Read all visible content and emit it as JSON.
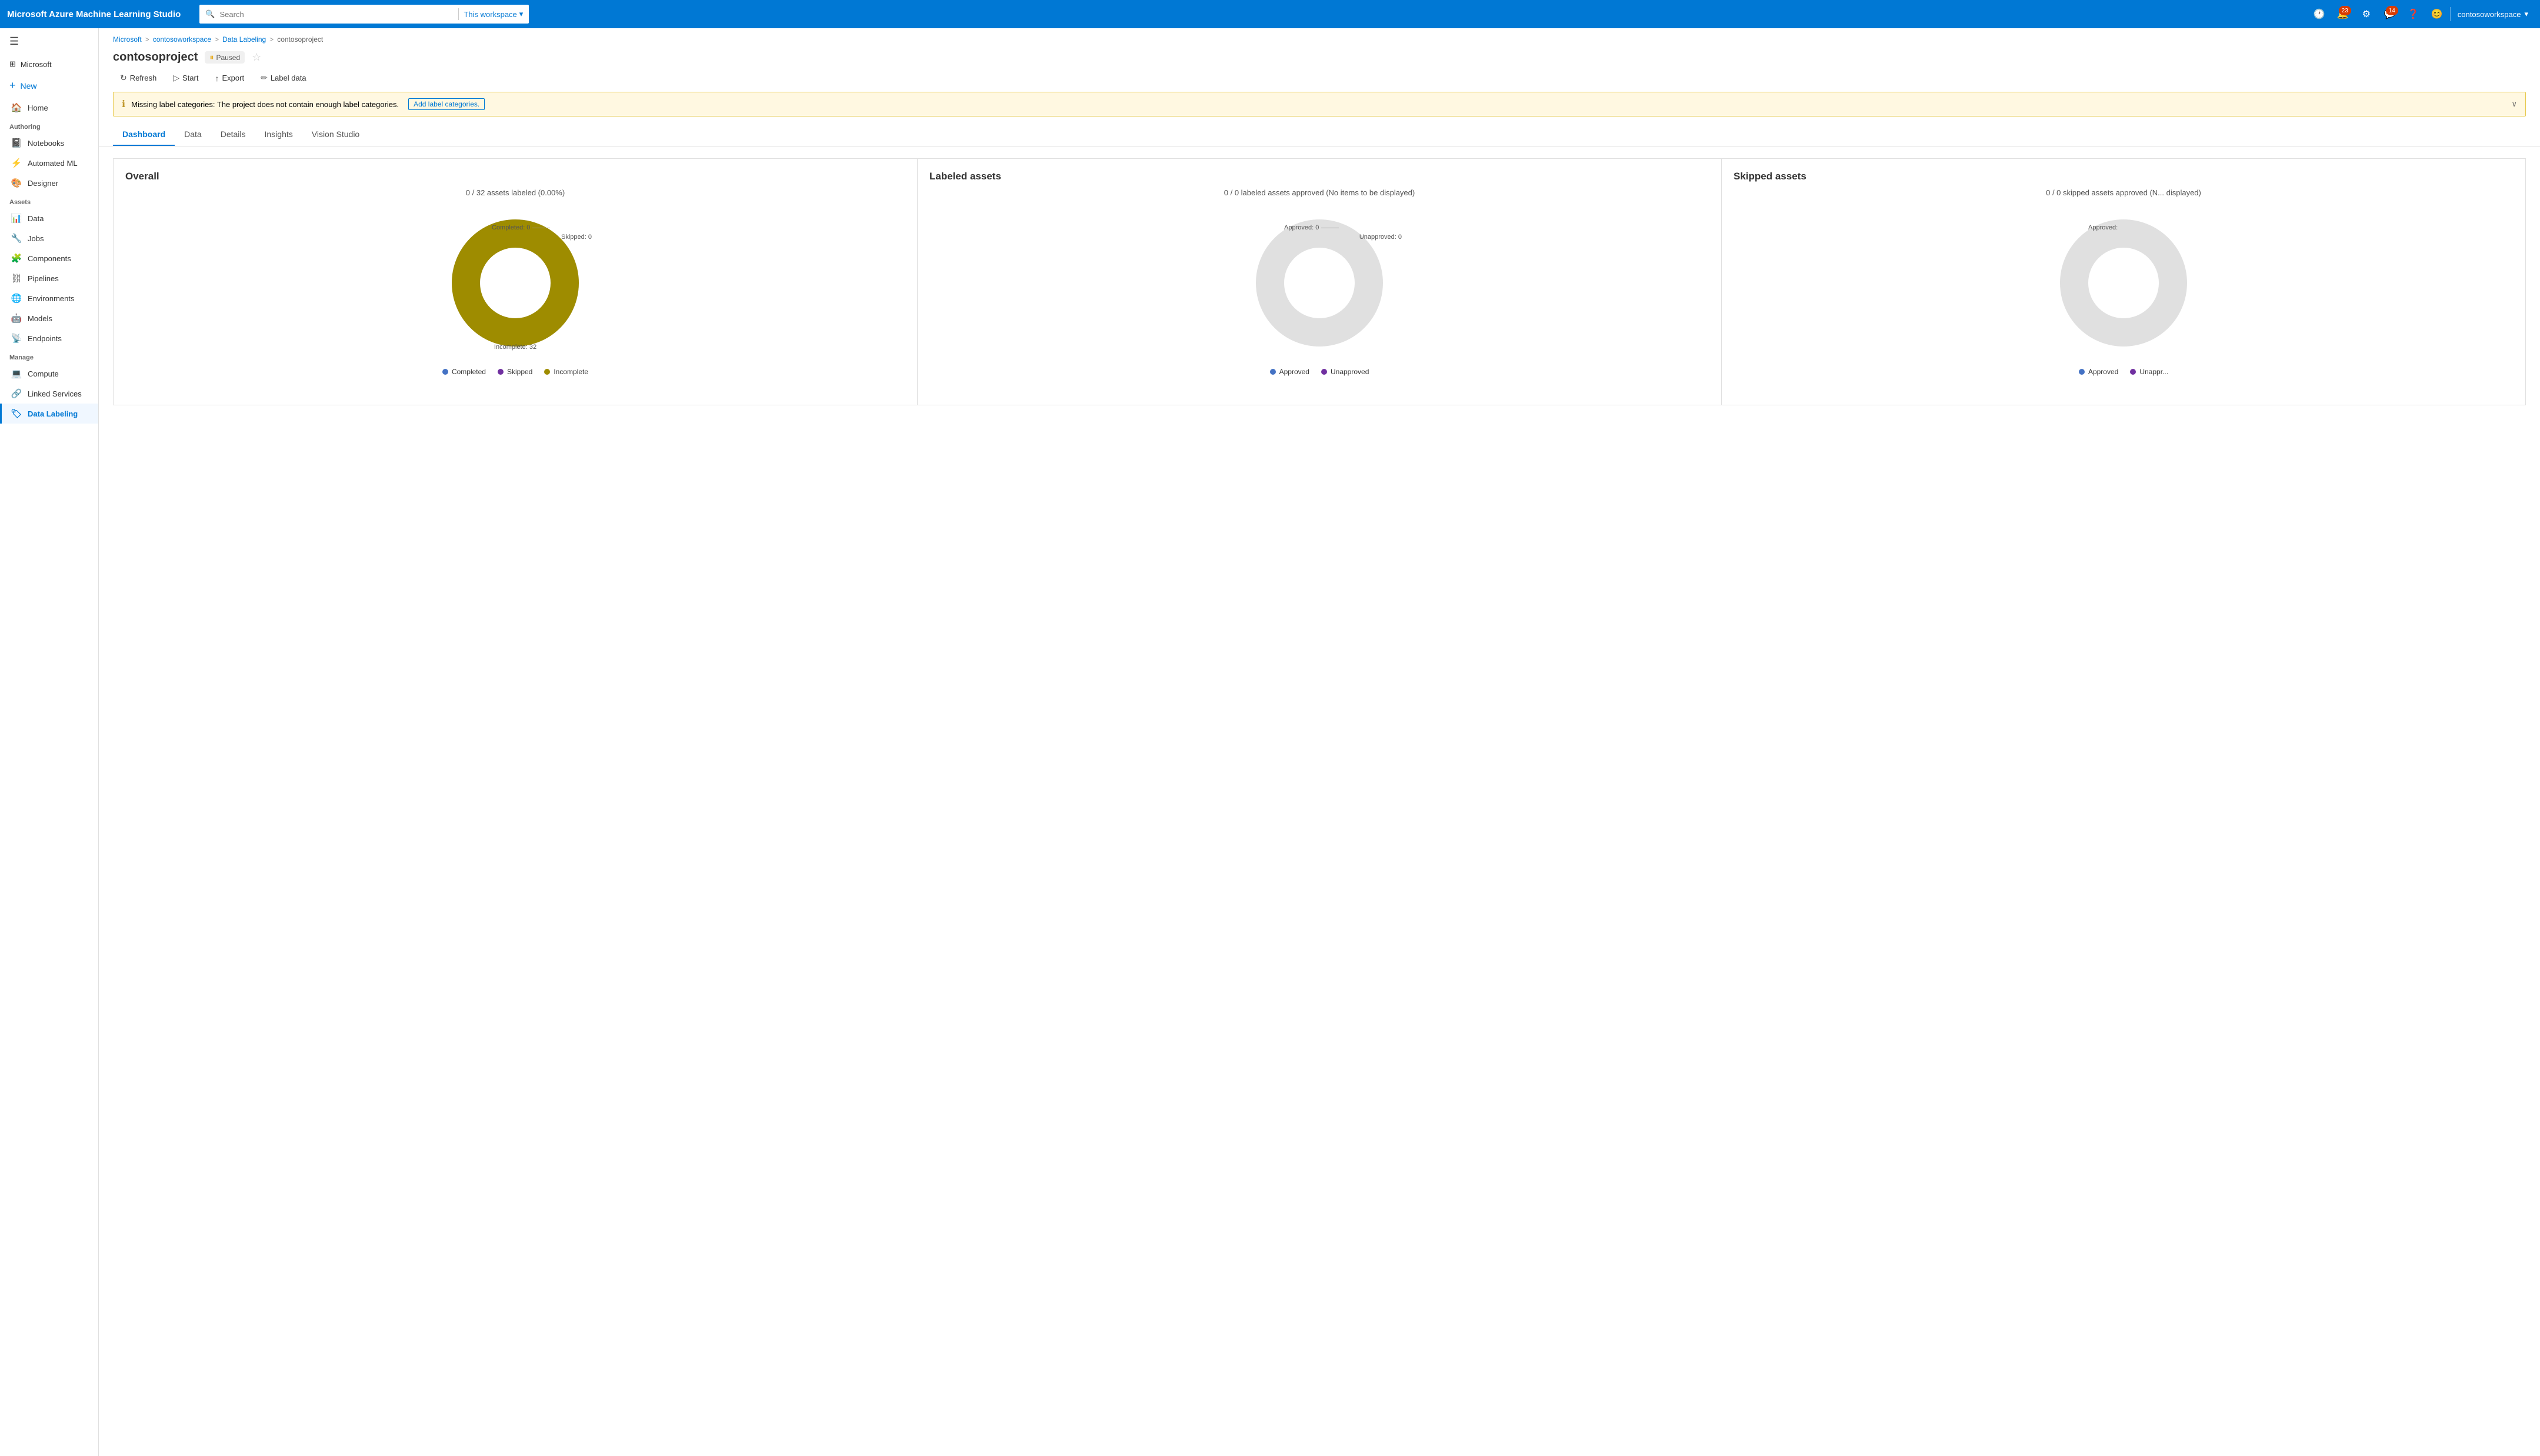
{
  "app": {
    "title": "Microsoft Azure Machine Learning Studio"
  },
  "topbar": {
    "search_placeholder": "Search",
    "workspace_label": "This workspace",
    "notifications_badge": "23",
    "updates_badge": "14",
    "username": "contosoworkspace"
  },
  "breadcrumb": {
    "items": [
      "Microsoft",
      "contosoworkspace",
      "Data Labeling",
      "contosoproject"
    ]
  },
  "page": {
    "title": "contosoproject",
    "status": "Paused"
  },
  "toolbar": {
    "refresh": "Refresh",
    "start": "Start",
    "export": "Export",
    "label_data": "Label data"
  },
  "warning": {
    "message": "Missing label categories: The project does not contain enough label categories.",
    "link": "Add label categories."
  },
  "tabs": {
    "items": [
      "Dashboard",
      "Data",
      "Details",
      "Insights",
      "Vision Studio"
    ],
    "active": "Dashboard"
  },
  "sidebar": {
    "ms_label": "Microsoft",
    "new_label": "New",
    "sections": {
      "authoring_label": "Authoring",
      "assets_label": "Assets",
      "manage_label": "Manage"
    },
    "authoring_items": [
      {
        "label": "Notebooks",
        "icon": "📓"
      },
      {
        "label": "Automated ML",
        "icon": "⚡"
      },
      {
        "label": "Designer",
        "icon": "🎨"
      }
    ],
    "assets_items": [
      {
        "label": "Data",
        "icon": "📊"
      },
      {
        "label": "Jobs",
        "icon": "🔧"
      },
      {
        "label": "Components",
        "icon": "🧩"
      },
      {
        "label": "Pipelines",
        "icon": "⛓"
      },
      {
        "label": "Environments",
        "icon": "🌐"
      },
      {
        "label": "Models",
        "icon": "🤖"
      },
      {
        "label": "Endpoints",
        "icon": "📡"
      }
    ],
    "manage_items": [
      {
        "label": "Compute",
        "icon": "💻"
      },
      {
        "label": "Linked Services",
        "icon": "🔗"
      },
      {
        "label": "Data Labeling",
        "icon": "🏷",
        "active": true
      }
    ]
  },
  "dashboard": {
    "overall": {
      "title": "Overall",
      "subtitle": "0 / 32 assets labeled (0.00%)",
      "completed_label": "Completed: 0",
      "skipped_label": "Skipped: 0",
      "incomplete_label": "Incomplete: 32",
      "legend": [
        {
          "label": "Completed",
          "color": "#4472c4"
        },
        {
          "label": "Skipped",
          "color": "#7030a0"
        },
        {
          "label": "Incomplete",
          "color": "#9e8c00"
        }
      ],
      "donut_color": "#9e8c00",
      "donut_percent": 100
    },
    "labeled": {
      "title": "Labeled assets",
      "subtitle": "0 / 0 labeled assets approved (No items to be displayed)",
      "approved_label": "Approved: 0",
      "unapproved_label": "Unapproved: 0",
      "legend": [
        {
          "label": "Approved",
          "color": "#4472c4"
        },
        {
          "label": "Unapproved",
          "color": "#7030a0"
        }
      ]
    },
    "skipped": {
      "title": "Skipped assets",
      "subtitle": "0 / 0 skipped assets approved (N... displayed)",
      "approved_label": "Approved:",
      "legend": [
        {
          "label": "Approved",
          "color": "#4472c4"
        },
        {
          "label": "Unappr...",
          "color": "#7030a0"
        }
      ]
    }
  }
}
